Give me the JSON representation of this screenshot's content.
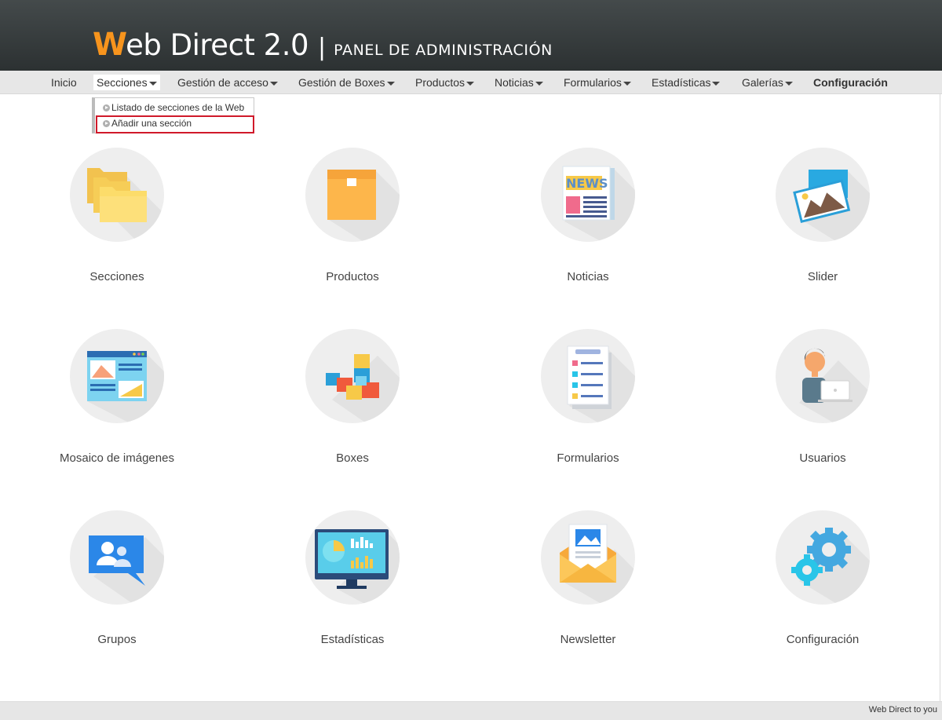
{
  "header": {
    "logo_w": "W",
    "logo_rest": "eb Direct 2.0",
    "separator": "|",
    "subtitle": "PANEL DE ADMINISTRACIÓN",
    "accent_color": "#f7941d"
  },
  "nav": {
    "items": [
      {
        "label": "Inicio"
      },
      {
        "label": "Secciones"
      },
      {
        "label": "Gestión de acceso"
      },
      {
        "label": "Gestión de Boxes"
      },
      {
        "label": "Productos"
      },
      {
        "label": "Noticias"
      },
      {
        "label": "Formularios"
      },
      {
        "label": "Estadísticas"
      },
      {
        "label": "Galerías"
      },
      {
        "label": "Configuración"
      }
    ]
  },
  "dropdown": {
    "items": [
      {
        "label": "Listado de secciones de la Web"
      },
      {
        "label": "Añadir una sección"
      }
    ],
    "highlight_color": "#d0192a"
  },
  "tiles": [
    {
      "label": "Secciones",
      "icon": "folder-icon"
    },
    {
      "label": "Productos",
      "icon": "box-icon"
    },
    {
      "label": "Noticias",
      "icon": "newspaper-icon"
    },
    {
      "label": "Slider",
      "icon": "image-slider-icon"
    },
    {
      "label": "Mosaico de imágenes",
      "icon": "image-mosaic-icon"
    },
    {
      "label": "Boxes",
      "icon": "cubes-icon"
    },
    {
      "label": "Formularios",
      "icon": "form-icon"
    },
    {
      "label": "Usuarios",
      "icon": "user-laptop-icon"
    },
    {
      "label": "Grupos",
      "icon": "group-chat-icon"
    },
    {
      "label": "Estadísticas",
      "icon": "monitor-chart-icon"
    },
    {
      "label": "Newsletter",
      "icon": "envelope-icon"
    },
    {
      "label": "Configuración",
      "icon": "gears-icon"
    }
  ],
  "footer": {
    "text": "Web Direct to you"
  }
}
